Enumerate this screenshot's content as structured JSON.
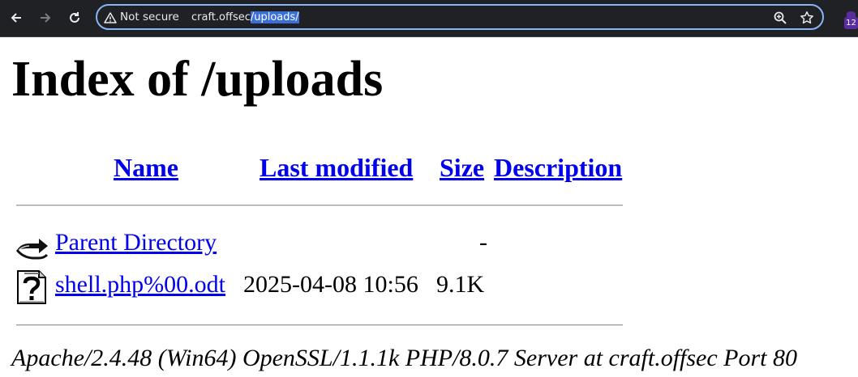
{
  "browser": {
    "security_label": "Not secure",
    "url_host": "craft.offsec",
    "url_path": "/uploads/",
    "extension_badge": "12"
  },
  "page": {
    "title": "Index of /uploads",
    "columns": {
      "name": "Name",
      "last_modified": "Last modified",
      "size": "Size",
      "description": "Description"
    },
    "rows": [
      {
        "icon": "back-arrow-icon",
        "name": "Parent Directory",
        "last_modified": "",
        "size": "-",
        "description": ""
      },
      {
        "icon": "unknown-file-icon",
        "name": "shell.php%00.odt",
        "last_modified": "2025-04-08 10:56",
        "size": "9.1K",
        "description": ""
      }
    ],
    "footer": "Apache/2.4.48 (Win64) OpenSSL/1.1.1k PHP/8.0.7 Server at craft.offsec Port 80"
  },
  "colors": {
    "toolbar_bg": "#202124",
    "omnibox_focus": "#8ab4f8",
    "link": "#0000ee",
    "url_selection": "#3a6fd8"
  }
}
